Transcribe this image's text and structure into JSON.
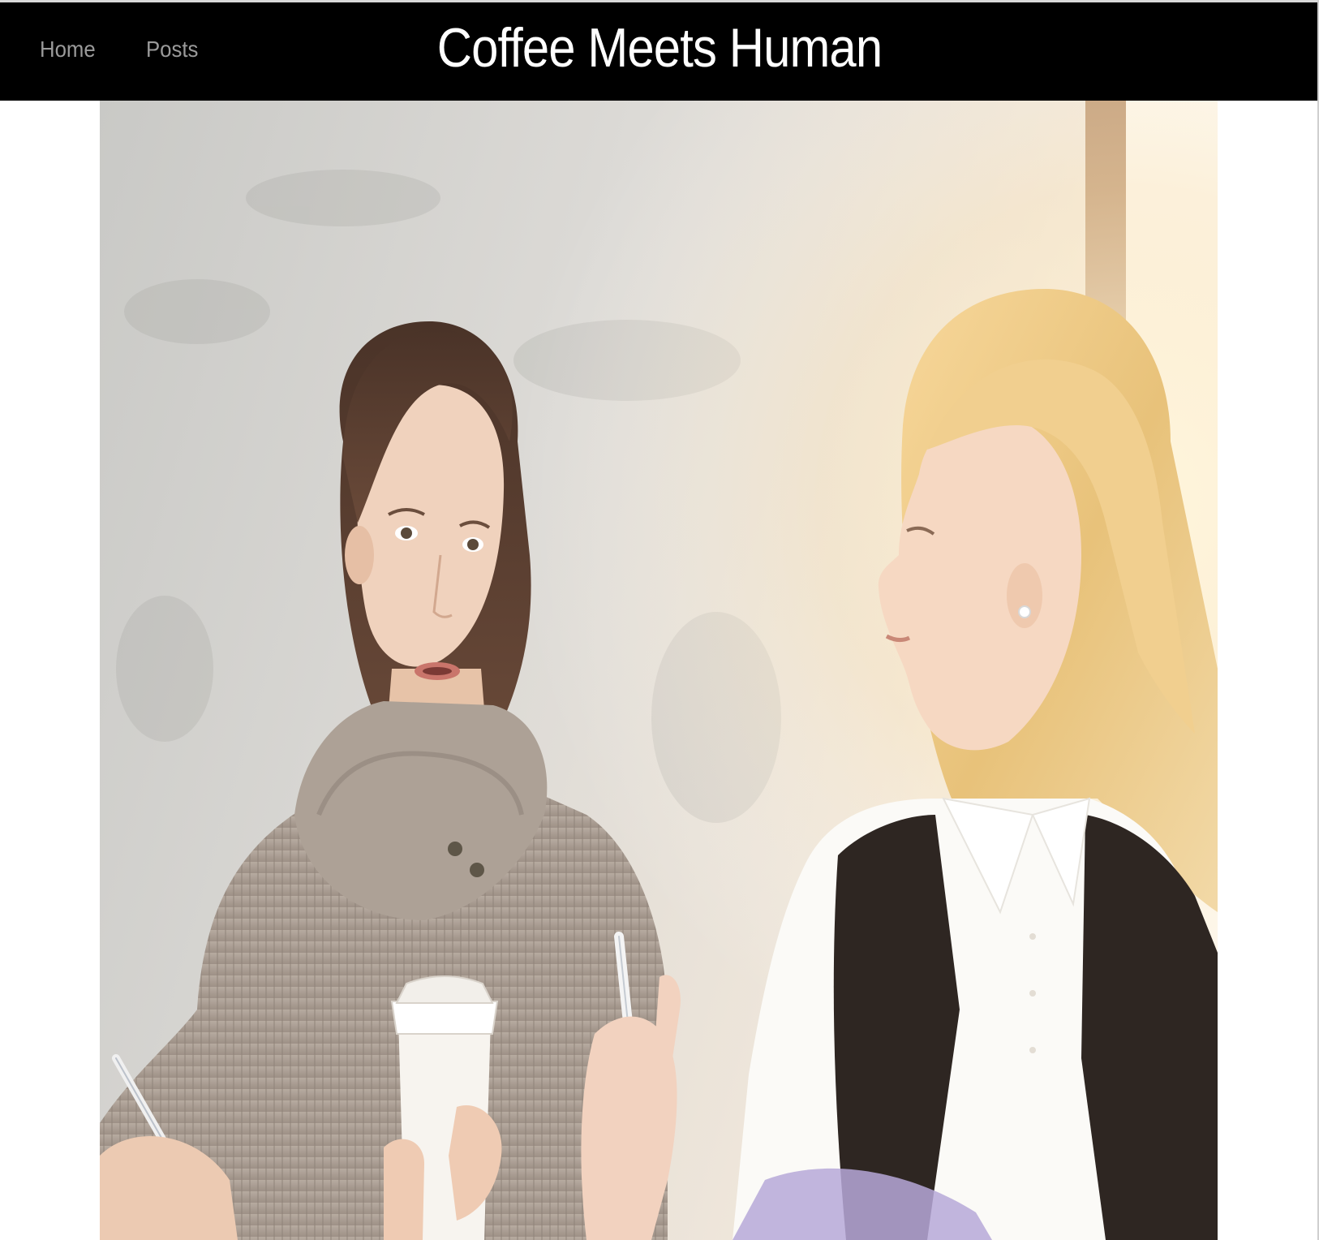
{
  "nav": {
    "items": [
      {
        "label": "Home"
      },
      {
        "label": "Posts"
      }
    ]
  },
  "header": {
    "title": "Coffee Meets Human"
  },
  "hero": {
    "image_semantic": "two-women-talking-over-coffee-photo"
  },
  "colors": {
    "header_bg": "#000000",
    "header_title": "#ffffff",
    "nav_link": "#9a9a9a",
    "page_bg": "#ffffff"
  }
}
